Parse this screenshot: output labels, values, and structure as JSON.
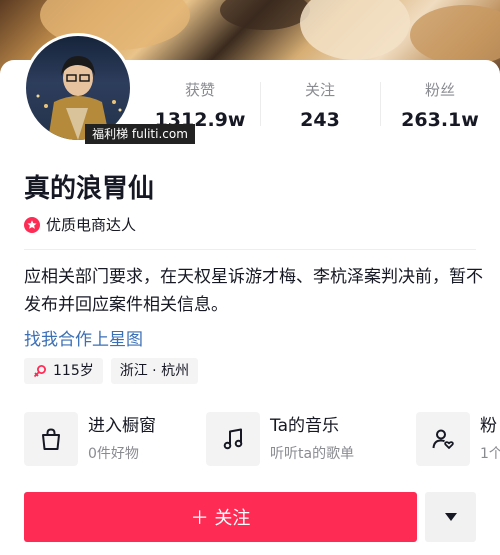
{
  "stats": [
    {
      "label": "获赞",
      "value": "1312.9w"
    },
    {
      "label": "关注",
      "value": "243"
    },
    {
      "label": "粉丝",
      "value": "263.1w"
    }
  ],
  "watermark": "福利梯 fuliti.com",
  "profile": {
    "name": "真的浪胃仙",
    "badge": "优质电商达人",
    "bio": "应相关部门要求，在天权星诉游才梅、李杭泽案判决前，暂不发布并回应案件相关信息。",
    "link": "找我合作上星图",
    "tags": {
      "age": "115岁",
      "location": "浙江 · 杭州"
    }
  },
  "features": [
    {
      "title": "进入橱窗",
      "subtitle": "0件好物",
      "icon": "shopping-bag-icon"
    },
    {
      "title": "Ta的音乐",
      "subtitle": "听听ta的歌单",
      "icon": "music-note-icon"
    },
    {
      "title": "粉",
      "subtitle": "1个",
      "icon": "fans-group-icon"
    }
  ],
  "actions": {
    "follow": "＋ 关注",
    "more_icon": "triangle-down-icon"
  },
  "colors": {
    "accent": "#fe2c55",
    "link": "#3b6fb6",
    "muted": "#8a8b91"
  }
}
